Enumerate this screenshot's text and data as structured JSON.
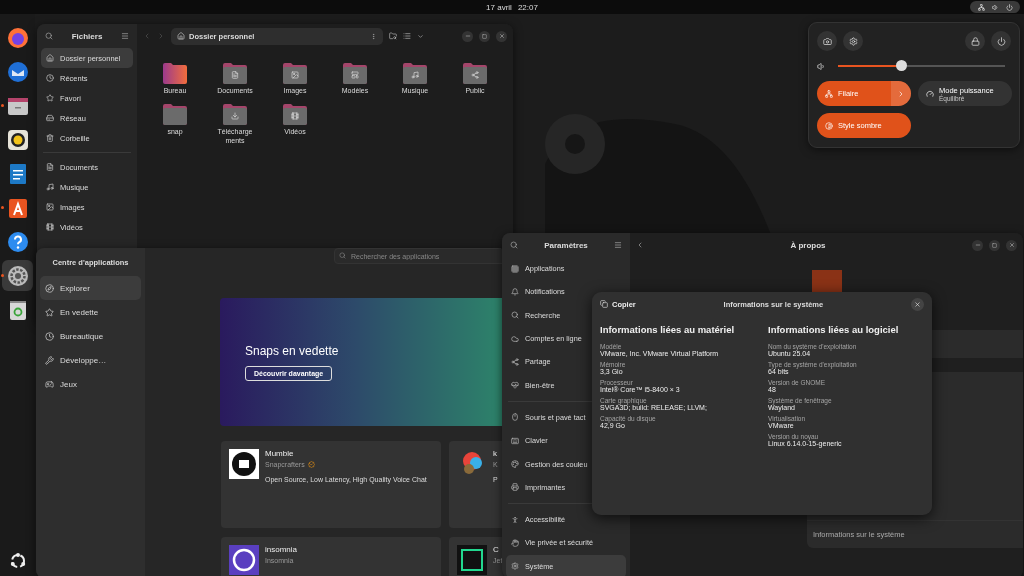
{
  "top_bar": {
    "date": "17 avril",
    "time": "22:07"
  },
  "dock": [
    {
      "kind": "browser",
      "running": false,
      "selected": false
    },
    {
      "kind": "mail",
      "running": false,
      "selected": false
    },
    {
      "kind": "files",
      "running": true,
      "selected": false
    },
    {
      "kind": "speaker",
      "running": false,
      "selected": false
    },
    {
      "kind": "writer",
      "running": false,
      "selected": false
    },
    {
      "kind": "store",
      "running": true,
      "selected": false
    },
    {
      "kind": "help",
      "running": false,
      "selected": false
    },
    {
      "kind": "settings",
      "running": true,
      "selected": true
    },
    {
      "kind": "trash",
      "running": false,
      "selected": false
    }
  ],
  "files_window": {
    "title": "Fichiers",
    "path": "Dossier personnel",
    "sidebar": [
      [
        {
          "kind": "home",
          "label": "Dossier personnel",
          "selected": true
        },
        {
          "kind": "recent",
          "label": "Récents",
          "selected": false
        },
        {
          "kind": "star",
          "label": "Favori",
          "selected": false
        },
        {
          "kind": "network",
          "label": "Réseau",
          "selected": false
        },
        {
          "kind": "trash",
          "label": "Corbeille",
          "selected": false
        }
      ],
      [
        {
          "kind": "documents",
          "label": "Documents",
          "selected": false
        },
        {
          "kind": "music",
          "label": "Musique",
          "selected": false
        },
        {
          "kind": "pictures",
          "label": "Images",
          "selected": false
        },
        {
          "kind": "videos",
          "label": "Vidéos",
          "selected": false
        }
      ]
    ],
    "folders": [
      {
        "kind": "desktop",
        "label": "Bureau"
      },
      {
        "kind": "documents",
        "label": "Documents"
      },
      {
        "kind": "pictures",
        "label": "Images"
      },
      {
        "kind": "templates",
        "label": "Modèles"
      },
      {
        "kind": "music",
        "label": "Musique"
      },
      {
        "kind": "public",
        "label": "Public"
      },
      {
        "kind": "plain",
        "label": "snap"
      },
      {
        "kind": "downloads",
        "label": "Télécharge ments"
      },
      {
        "kind": "videos",
        "label": "Vidéos"
      }
    ]
  },
  "quick_settings": {
    "volume": {
      "level": 0.38
    },
    "toggles": [
      {
        "kind": "network",
        "label": "Filaire",
        "on": true,
        "arrow": true
      },
      {
        "kind": "power",
        "label": "Mode puissance",
        "subtitle": "Équilibré",
        "on": false,
        "arrow": false
      },
      {
        "kind": "dark",
        "label": "Style sombre",
        "on": true,
        "arrow": false
      }
    ]
  },
  "app_center": {
    "title": "Centre d'applications",
    "search": {
      "placeholder": "Rechercher des applications"
    },
    "nav": [
      {
        "kind": "explore",
        "label": "Explorer",
        "selected": true
      },
      {
        "kind": "featured",
        "label": "En vedette",
        "selected": false
      },
      {
        "kind": "office",
        "label": "Bureautique",
        "selected": false
      },
      {
        "kind": "dev",
        "label": "Développe…",
        "selected": false
      },
      {
        "kind": "games",
        "label": "Jeux",
        "selected": false
      }
    ],
    "banner": {
      "title": "Snaps en vedette",
      "button": "Découvrir davantage"
    },
    "cards": [
      {
        "kind": "mumble",
        "name": "Mumble",
        "publisher": "Snapcrafters",
        "verified": true,
        "description": "Open Source, Low Latency, High Quality Voice Chat"
      },
      {
        "kind": "paint",
        "name": "k",
        "publisher": "K",
        "verified": false,
        "description": "P"
      },
      {
        "kind": "insomnia",
        "name": "insomnia",
        "publisher": "Insomnia",
        "verified": false
      },
      {
        "kind": "clion",
        "name": "C",
        "publisher": "Jet"
      }
    ]
  },
  "settings_window": {
    "title": "Paramètres",
    "page_title": "À propos",
    "info_row": "Informations sur le système",
    "sidebar": [
      [
        {
          "kind": "apps",
          "label": "Applications",
          "selected": false
        },
        {
          "kind": "bell",
          "label": "Notifications",
          "selected": false
        },
        {
          "kind": "search",
          "label": "Recherche",
          "selected": false
        },
        {
          "kind": "cloud",
          "label": "Comptes en ligne",
          "selected": false
        },
        {
          "kind": "share",
          "label": "Partage",
          "selected": false
        },
        {
          "kind": "wellbeing",
          "label": "Bien-être",
          "selected": false
        }
      ],
      [
        {
          "kind": "mouse",
          "label": "Souris et pavé tact",
          "selected": false
        },
        {
          "kind": "keyboard",
          "label": "Clavier",
          "selected": false
        },
        {
          "kind": "color",
          "label": "Gestion des couleu",
          "selected": false
        },
        {
          "kind": "printer",
          "label": "Imprimantes",
          "selected": false
        }
      ],
      [
        {
          "kind": "access",
          "label": "Accessibilité",
          "selected": false
        },
        {
          "kind": "privacy",
          "label": "Vie privée et sécurité",
          "selected": false
        },
        {
          "kind": "system",
          "label": "Système",
          "selected": true
        }
      ]
    ]
  },
  "system_info_dialog": {
    "title": "Informations sur le système",
    "copy_button": "Copier",
    "columns": [
      {
        "heading": "Informations liées au matériel",
        "fields": [
          {
            "label": "Modèle",
            "value": "VMware, Inc. VMware Virtual Platform"
          },
          {
            "label": "Mémoire",
            "value": "3,3 Gio"
          },
          {
            "label": "Processeur",
            "value": "Intel® Core™ i5-8400 × 3"
          },
          {
            "label": "Carte graphique",
            "value": "SVGA3D; build: RELEASE; LLVM;"
          },
          {
            "label": "Capacité du disque",
            "value": "42,9 Go"
          }
        ]
      },
      {
        "heading": "Informations liées au logiciel",
        "fields": [
          {
            "label": "Nom du système d'exploitation",
            "value": "Ubuntu 25.04"
          },
          {
            "label": "Type de système d'exploitation",
            "value": "64 bits"
          },
          {
            "label": "Version de GNOME",
            "value": "48"
          },
          {
            "label": "Système de fenêtrage",
            "value": "Wayland"
          },
          {
            "label": "Virtualisation",
            "value": "VMware"
          },
          {
            "label": "Version du noyau",
            "value": "Linux 6.14.0-15-generic"
          }
        ]
      }
    ]
  }
}
